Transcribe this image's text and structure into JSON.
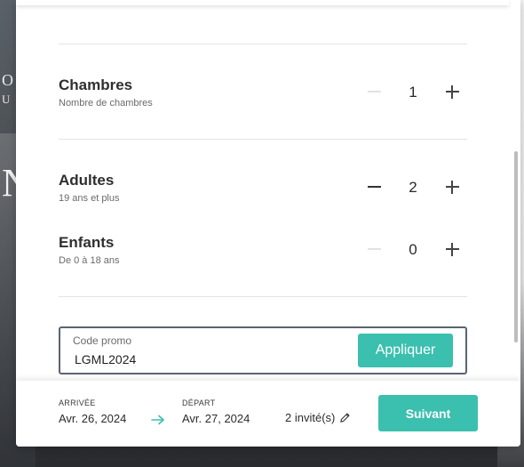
{
  "background": {
    "text_line1": "O",
    "text_line2": "U S",
    "text_big": "N"
  },
  "rooms": {
    "title": "Chambres",
    "subtitle": "Nombre de chambres",
    "value": "1",
    "minus_disabled": true
  },
  "adults": {
    "title": "Adultes",
    "subtitle": "19 ans et plus",
    "value": "2",
    "minus_disabled": false
  },
  "children": {
    "title": "Enfants",
    "subtitle": "De 0 à 18 ans",
    "value": "0",
    "minus_disabled": true
  },
  "promo": {
    "label": "Code promo",
    "value": "LGML2024",
    "apply_label": "Appliquer"
  },
  "footer": {
    "arrival_label": "ARRIVÉE",
    "arrival_date": "Avr. 26, 2024",
    "departure_label": "DÉPART",
    "departure_date": "Avr. 27, 2024",
    "guests": "2 invité(s)",
    "next_label": "Suivant"
  },
  "colors": {
    "accent": "#3bbfae",
    "border": "#5a6470"
  },
  "icons": {
    "minus": "minus-icon",
    "plus": "plus-icon",
    "arrow": "arrow-right-icon",
    "edit": "pencil-icon"
  }
}
